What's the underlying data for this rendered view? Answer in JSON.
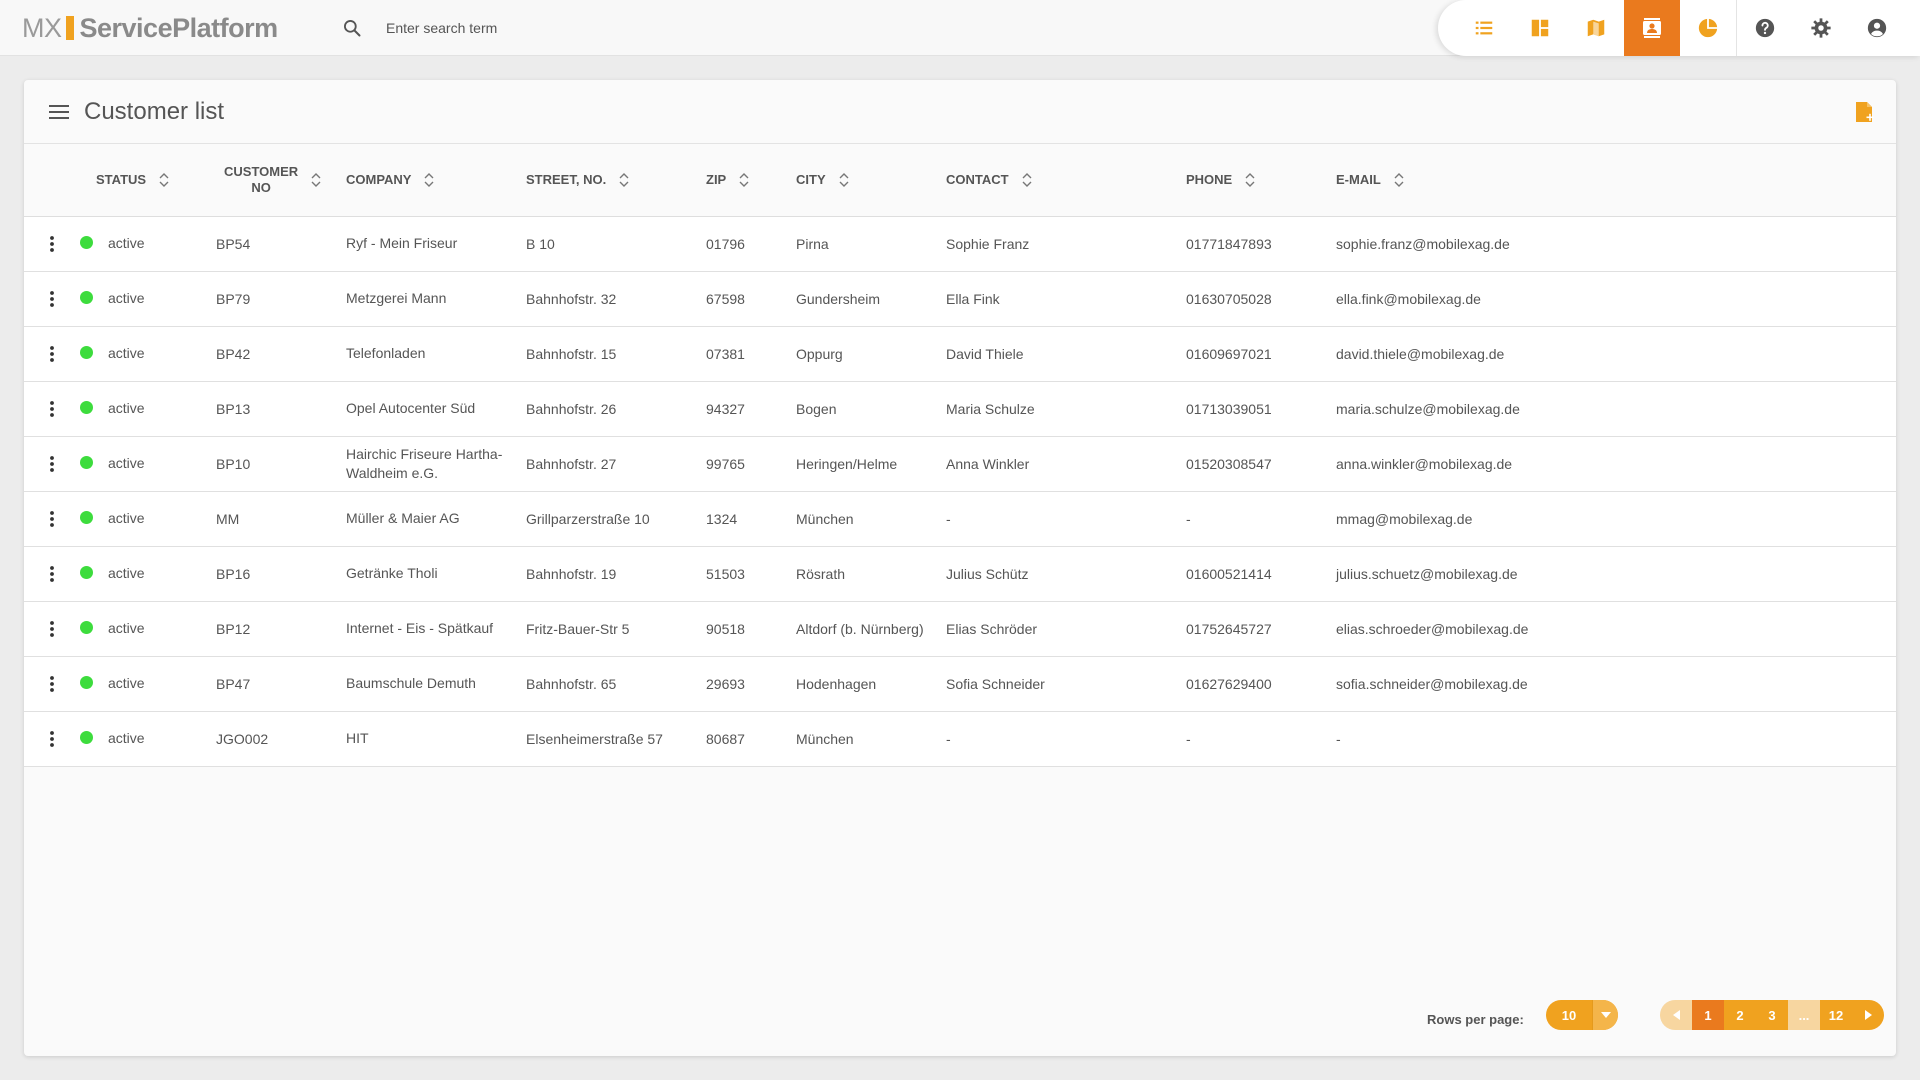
{
  "app": {
    "logo_mx": "MX",
    "logo_name": "ServicePlatform"
  },
  "search": {
    "placeholder": "Enter search term"
  },
  "nav": {
    "icons": [
      "list-icon",
      "dashboard-icon",
      "map-icon",
      "contact-icon",
      "pie-chart-icon",
      "help-icon",
      "settings-icon",
      "account-icon"
    ],
    "active": "contact-icon",
    "accent_color": "#f0a21f",
    "active_color": "#ea7a1e"
  },
  "card": {
    "title": "Customer list"
  },
  "table": {
    "headers": {
      "status": "STATUS",
      "customer_no_1": "CUSTOMER",
      "customer_no_2": "NO",
      "company": "COMPANY",
      "street": "STREET, NO.",
      "zip": "ZIP",
      "city": "CITY",
      "contact": "CONTACT",
      "phone": "PHONE",
      "email": "E-MAIL"
    },
    "status_color": "#3ddc3d",
    "rows": [
      {
        "status": "active",
        "no": "BP54",
        "company": "Ryf - Mein Friseur",
        "street": "B 10",
        "zip": "01796",
        "city": "Pirna",
        "contact": "Sophie Franz",
        "phone": "01771847893",
        "email": "sophie.franz@mobilexag.de"
      },
      {
        "status": "active",
        "no": "BP79",
        "company": "Metzgerei Mann",
        "street": "Bahnhofstr. 32",
        "zip": "67598",
        "city": "Gundersheim",
        "contact": "Ella Fink",
        "phone": "01630705028",
        "email": "ella.fink@mobilexag.de"
      },
      {
        "status": "active",
        "no": "BP42",
        "company": "Telefonladen",
        "street": "Bahnhofstr. 15",
        "zip": "07381",
        "city": "Oppurg",
        "contact": "David Thiele",
        "phone": "01609697021",
        "email": "david.thiele@mobilexag.de"
      },
      {
        "status": "active",
        "no": "BP13",
        "company": "Opel Autocenter Süd",
        "street": "Bahnhofstr. 26",
        "zip": "94327",
        "city": "Bogen",
        "contact": "Maria Schulze",
        "phone": "01713039051",
        "email": "maria.schulze@mobilexag.de"
      },
      {
        "status": "active",
        "no": "BP10",
        "company": "Hairchic Friseure Hartha-Waldheim e.G.",
        "street": "Bahnhofstr. 27",
        "zip": "99765",
        "city": "Heringen/Helme",
        "contact": "Anna Winkler",
        "phone": "01520308547",
        "email": "anna.winkler@mobilexag.de"
      },
      {
        "status": "active",
        "no": "MM",
        "company": "Müller & Maier AG",
        "street": "Grillparzerstraße 10",
        "zip": "1324",
        "city": "München",
        "contact": "-",
        "phone": "-",
        "email": "mmag@mobilexag.de"
      },
      {
        "status": "active",
        "no": "BP16",
        "company": "Getränke Tholi",
        "street": "Bahnhofstr. 19",
        "zip": "51503",
        "city": "Rösrath",
        "contact": "Julius Schütz",
        "phone": "01600521414",
        "email": "julius.schuetz@mobilexag.de"
      },
      {
        "status": "active",
        "no": "BP12",
        "company": "Internet - Eis - Spätkauf",
        "street": "Fritz-Bauer-Str 5",
        "zip": "90518",
        "city": "Altdorf (b. Nürnberg)",
        "contact": "Elias Schröder",
        "phone": "01752645727",
        "email": "elias.schroeder@mobilexag.de"
      },
      {
        "status": "active",
        "no": "BP47",
        "company": "Baumschule Demuth",
        "street": "Bahnhofstr. 65",
        "zip": "29693",
        "city": "Hodenhagen",
        "contact": "Sofia Schneider",
        "phone": "01627629400",
        "email": "sofia.schneider@mobilexag.de"
      },
      {
        "status": "active",
        "no": "JGO002",
        "company": "HIT",
        "street": "Elsenheimerstraße 57",
        "zip": "80687",
        "city": "München",
        "contact": "-",
        "phone": "-",
        "email": "-"
      }
    ]
  },
  "pagination": {
    "rows_per_page_label": "Rows per page:",
    "rows_per_page": "10",
    "pages": [
      "1",
      "2",
      "3",
      "...",
      "12"
    ],
    "current": "1"
  }
}
